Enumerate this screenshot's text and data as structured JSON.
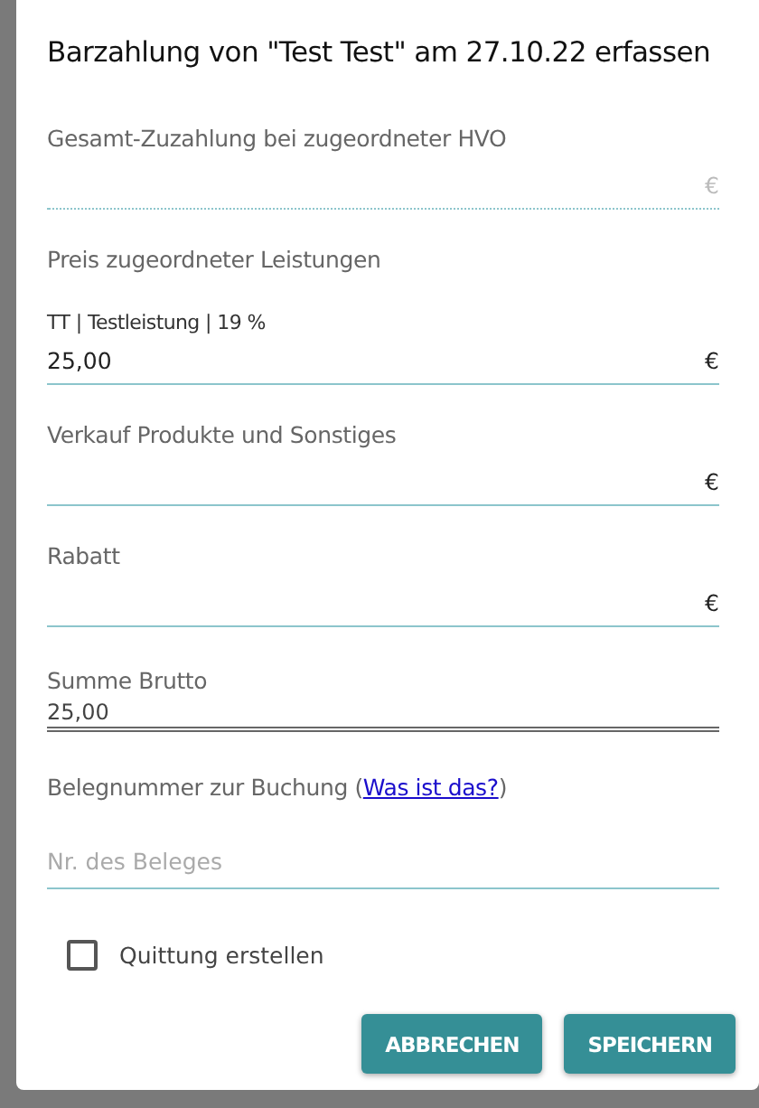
{
  "dialog": {
    "title": "Barzahlung von \"Test Test\" am 27.10.22 erfassen"
  },
  "fields": [
    {
      "kind": "amount",
      "label": "Gesamt-Zuzahlung bei zugeordneter HVO",
      "suffix": "€",
      "disabled": true
    },
    {
      "kind": "amount",
      "label": "Preis zugeordneter Leistungen",
      "sublabel": "TT | Testleistung | 19 %",
      "value": "25,00",
      "suffix": "€",
      "disabled": false
    },
    {
      "kind": "amount",
      "label": "Verkauf Produkte und Sonstiges",
      "suffix": "€",
      "disabled": false
    },
    {
      "kind": "amount",
      "label": "Rabatt",
      "suffix": "€",
      "disabled": false
    },
    {
      "kind": "total",
      "label": "Summe Brutto",
      "value": "25,00"
    },
    {
      "kind": "text",
      "label_before": "Belegnummer zur Buchung (",
      "link": "Was ist das?",
      "label_after": ")",
      "placeholder": "Nr. des Beleges"
    }
  ],
  "receipt_checkbox": {
    "label": "Quittung erstellen",
    "checked": false
  },
  "buttons": [
    "ABBRECHEN",
    "SPEICHERN"
  ]
}
